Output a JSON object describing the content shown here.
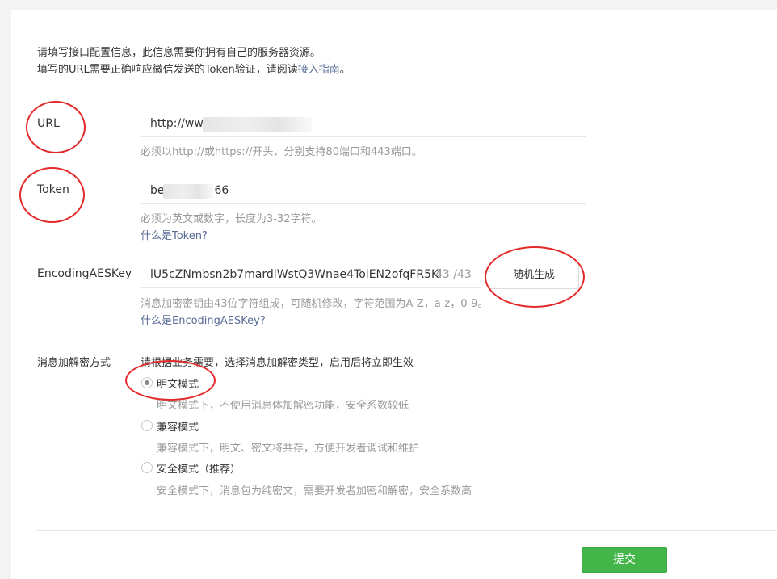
{
  "intro": {
    "line1": "请填写接口配置信息，此信息需要你拥有自己的服务器资源。",
    "line2_prefix": "填写的URL需要正确响应微信发送的Token验证，请阅读",
    "line2_link": "接入指南",
    "line2_suffix": "。"
  },
  "url": {
    "label": "URL",
    "value": "http://ww",
    "hint": "必须以http://或https://开头，分别支持80端口和443端口。"
  },
  "token": {
    "label": "Token",
    "value_prefix": "be",
    "value_suffix": "66",
    "hint": "必须为英文或数字，长度为3-32字符。",
    "help_link": "什么是Token?"
  },
  "aes": {
    "label": "EncodingAESKey",
    "value": "lU5cZNmbsn2b7mardlWstQ3Wnae4ToiEN2ofqFR5Kl",
    "counter": "43 /43",
    "generate_button": "随机生成",
    "hint": "消息加密密钥由43位字符组成，可随机修改，字符范围为A-Z，a-z，0-9。",
    "help_link": "什么是EncodingAESKey?"
  },
  "encryption": {
    "label": "消息加解密方式",
    "description": "请根据业务需要，选择消息加解密类型，启用后将立即生效",
    "options": [
      {
        "label": "明文模式",
        "hint": "明文模式下，不使用消息体加解密功能，安全系数较低",
        "checked": true
      },
      {
        "label": "兼容模式",
        "hint": "兼容模式下，明文、密文将共存，方便开发者调试和维护",
        "checked": false
      },
      {
        "label": "安全模式（推荐）",
        "hint": "安全模式下，消息包为纯密文，需要开发者加密和解密，安全系数高",
        "checked": false
      }
    ]
  },
  "submit_button": "提交",
  "colors": {
    "primary_green": "#44b549",
    "link_blue": "#576b95",
    "annotation_red": "#e32a2a"
  }
}
